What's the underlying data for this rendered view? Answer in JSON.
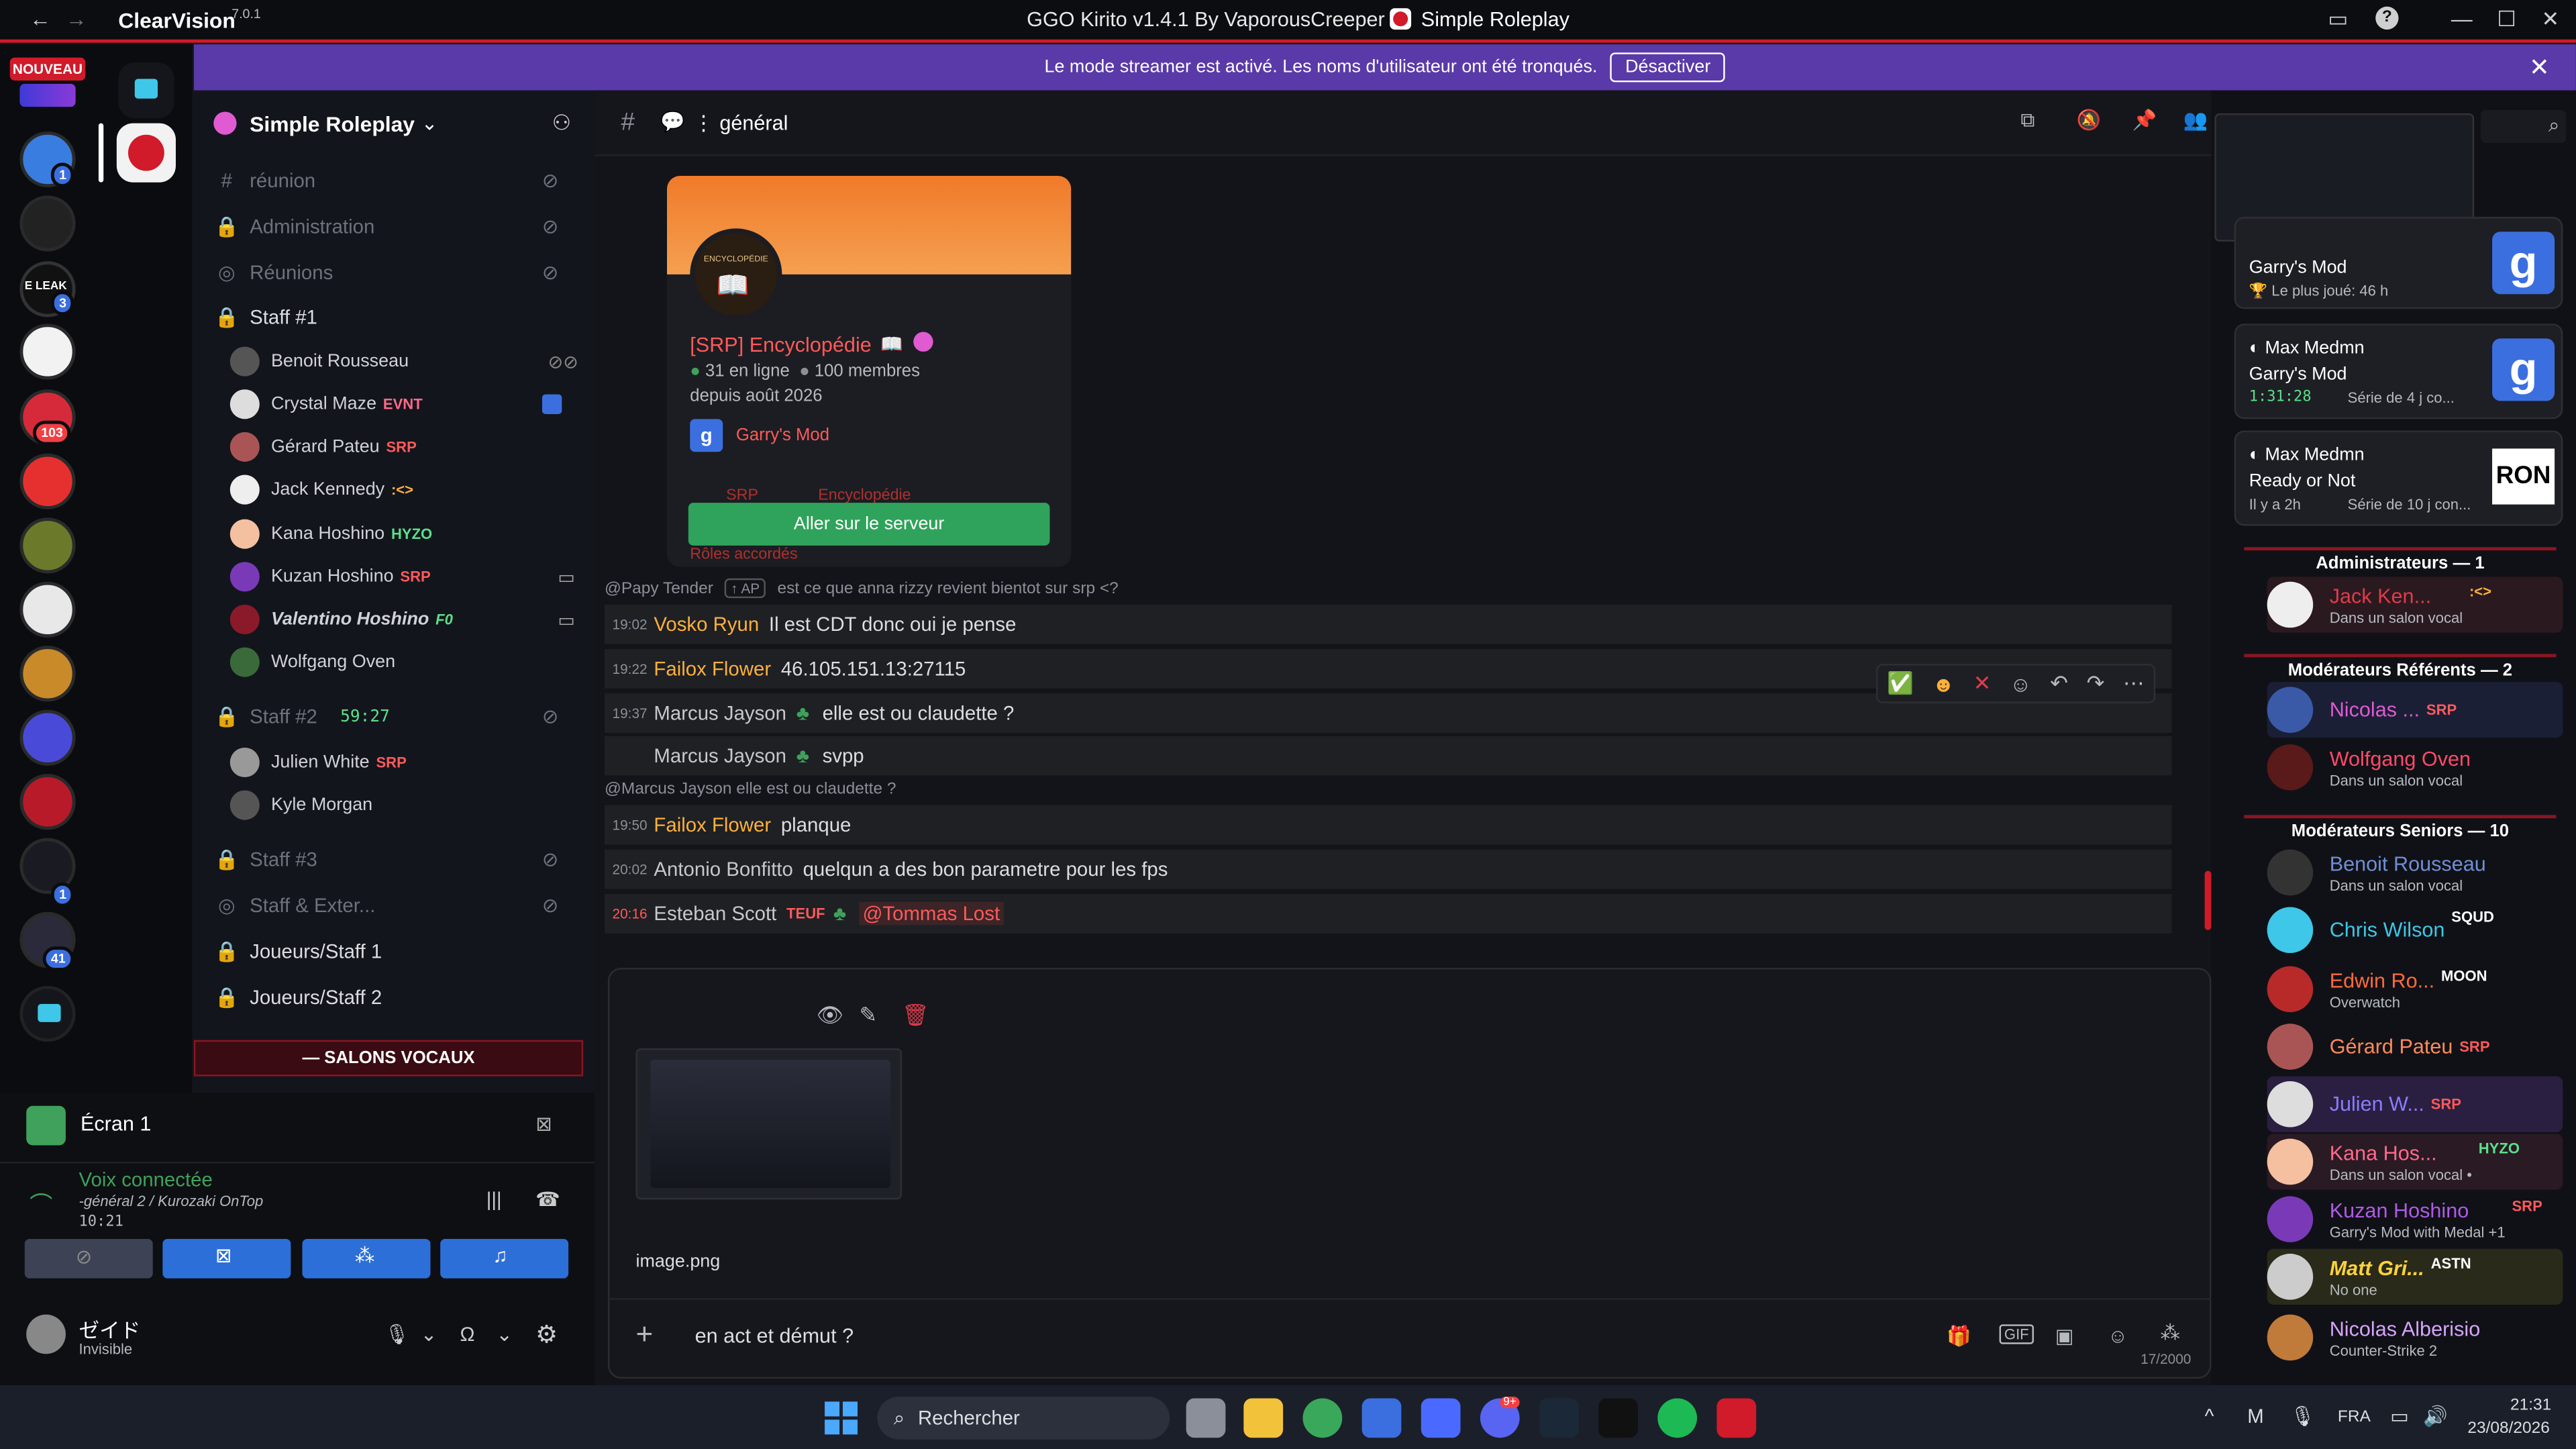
{
  "titlebar": {
    "brand": "ClearVision",
    "version": "7.0.1",
    "window_title": "GGO Kirito v1.4.1 By VaporousCreeper",
    "server_name": "Simple Roleplay"
  },
  "banner": {
    "text": "Le mode streamer est activé. Les noms d'utilisateur ont été tronqués.",
    "button": "Désactiver"
  },
  "rail": {
    "new_label": "NOUVEAU",
    "badges": [
      "1",
      "3",
      "103",
      "1",
      "41"
    ]
  },
  "channels": {
    "server_title": "Simple Roleplay",
    "items": [
      {
        "name": "réunion"
      },
      {
        "name": "Administration"
      },
      {
        "name": "Réunions"
      },
      {
        "name": "Staff #1"
      },
      {
        "name": "Staff #2",
        "timer": "59:27"
      },
      {
        "name": "Staff #3"
      },
      {
        "name": "Staff & Exter..."
      },
      {
        "name": "Joueurs/Staff 1"
      },
      {
        "name": "Joueurs/Staff 2"
      }
    ],
    "voice_members_1": [
      {
        "name": "Benoit Rousseau",
        "tag": ""
      },
      {
        "name": "Crystal Maze",
        "tag": "EVNT"
      },
      {
        "name": "Gérard Pateu",
        "tag": "SRP"
      },
      {
        "name": "Jack Kennedy",
        "tag": ":<>"
      },
      {
        "name": "Kana Hoshino",
        "tag": "HYZO"
      },
      {
        "name": "Kuzan Hoshino",
        "tag": "SRP"
      },
      {
        "name": "Valentino Hoshino",
        "tag": "F0"
      },
      {
        "name": "Wolfgang Oven",
        "tag": ""
      }
    ],
    "voice_members_2": [
      {
        "name": "Julien White",
        "tag": "SRP"
      },
      {
        "name": "Kyle Morgan",
        "tag": ""
      }
    ],
    "voice_section": "— SALONS VOCAUX"
  },
  "voice_panel": {
    "screen_label": "Écran 1",
    "status": "Voix connectée",
    "channel": "-général 2 / Kurozaki OnTop",
    "elapsed": "10:21",
    "user_name": "ゼイド",
    "user_status": "Invisible"
  },
  "chat": {
    "channel_name": "général",
    "card": {
      "title": "[SRP] Encyclopédie",
      "online": "31 en ligne",
      "members": "100 membres",
      "since": "depuis août 2026",
      "game": "Garry's Mod",
      "logo_text": "ENCYCLOPÉDIE",
      "behind_tags": "SRP",
      "behind_tags2": "Encyclopédie",
      "behind_roles": "Rôles accordés",
      "button": "Aller sur le serveur"
    },
    "messages": [
      {
        "reply": "@Papy Tender",
        "reply_tag": "AP",
        "reply_text": "est ce que anna rizzy revient bientot sur srp <?"
      },
      {
        "time": "19:02",
        "author": "Vosko Ryun",
        "text": "Il est CDT donc oui je pense"
      },
      {
        "time": "19:22",
        "author": "Failox Flower",
        "text": "46.105.151.13:27115"
      },
      {
        "time": "19:37",
        "author": "Marcus Jayson",
        "text": "elle est ou claudette ?"
      },
      {
        "time": "",
        "author": "Marcus Jayson",
        "text": "svpp"
      },
      {
        "reply": "@Marcus Jayson",
        "reply_text": "elle est ou claudette ?"
      },
      {
        "time": "19:50",
        "author": "Failox Flower",
        "text": "planque"
      },
      {
        "time": "20:02",
        "author": "Antonio Bonfitto",
        "text": "quelqun a des bon parametre pour les fps"
      },
      {
        "time": "20:16",
        "author": "Esteban Scott",
        "tag": "TEUF",
        "text": "@Tommas Lost"
      }
    ],
    "composer": {
      "attachment_name": "image.png",
      "draft": "en act et démut ?",
      "counter": "17/2000"
    }
  },
  "members": {
    "activities": [
      {
        "name": "",
        "game": "Garry's Mod",
        "detail": "Le plus joué: 46 h"
      },
      {
        "name": "Max Medmn",
        "game": "Garry's Mod",
        "detail": "1:31:28",
        "streak": "Série de 4 j co..."
      },
      {
        "name": "Max Medmn",
        "game": "Ready or Not",
        "detail": "Il y a 2h",
        "streak": "Série de 10 j con..."
      }
    ],
    "groups": [
      {
        "title": "Administrateurs — 1",
        "members": [
          {
            "name": "Jack Ken...",
            "tag": ":<>",
            "sub": "Dans un salon vocal",
            "color": "#e23a4a"
          }
        ]
      },
      {
        "title": "Modérateurs Référents — 2",
        "members": [
          {
            "name": "Nicolas ...",
            "tag": "SRP",
            "sub": "",
            "color": "#e05ad2"
          },
          {
            "name": "Wolfgang Oven",
            "tag": "",
            "sub": "Dans un salon vocal",
            "color": "#ff4a6a"
          }
        ]
      },
      {
        "title": "Modérateurs Seniors — 10",
        "members": [
          {
            "name": "Benoit Rousseau",
            "tag": "",
            "sub": "Dans un salon vocal",
            "color": "#6f8fd6"
          },
          {
            "name": "Chris Wilson",
            "tag": "SQUD",
            "sub": "",
            "color": "#3ec7e8"
          },
          {
            "name": "Edwin Ro...",
            "tag": "MOON",
            "sub": "Overwatch",
            "color": "#ff6a3a"
          },
          {
            "name": "Gérard Pateu",
            "tag": "SRP",
            "sub": "",
            "color": "#ff8a5a"
          },
          {
            "name": "Julien W...",
            "tag": "SRP",
            "sub": "",
            "color": "#8a7cff"
          },
          {
            "name": "Kana Hos...",
            "tag": "HYZO",
            "sub": "Dans un salon vocal •",
            "color": "#ff6a8a"
          },
          {
            "name": "Kuzan Hoshino",
            "tag": "SRP",
            "sub": "Garry's Mod with Medal +1",
            "color": "#b05ae8"
          },
          {
            "name": "Matt Gri...",
            "tag": "ASTN",
            "sub": "No one",
            "color": "#ffd23a"
          },
          {
            "name": "Nicolas Alberisio",
            "tag": "",
            "sub": "Counter-Strike 2",
            "color": "#d6a4ff"
          }
        ]
      }
    ]
  },
  "taskbar": {
    "search": "Rechercher",
    "lang": "FRA",
    "time": "21:31",
    "date": "23/08/2026",
    "discord_badge": "9+"
  },
  "colors": {
    "accent_red": "#d11a2a",
    "banner": "#5a3aa8",
    "green_button": "#2fa35b",
    "blurple": "#3b6fe0"
  }
}
